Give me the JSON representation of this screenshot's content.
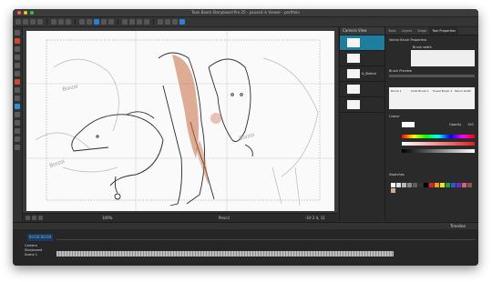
{
  "window": {
    "title": "Toon Boom Storyboard Pro 25 - paused in Viewer - portfolio"
  },
  "canvas": {
    "zoom": "100%",
    "view_mode": "Pencil",
    "coordinates": "-10 2 4, 11"
  },
  "layers": {
    "header": "Camera View",
    "items": [
      {
        "label": ""
      },
      {
        "label": ""
      },
      {
        "label": "A_Sketch"
      },
      {
        "label": ""
      },
      {
        "label": ""
      }
    ]
  },
  "tool_properties": {
    "tabs": [
      "Tools",
      "Layers",
      "Stage",
      "Tool Properties"
    ],
    "brush_title": "Vector Brush Properties",
    "brush_preset_label": "Brush width",
    "preview_label": "Brush Preview",
    "presets": [
      "Brush 1",
      "Solid Brush 1",
      "Fused Brush 1",
      "Pencil width"
    ],
    "color_section": "Colour",
    "opacity_label": "Opacity",
    "opacity_value": "100",
    "swatches_section": "Swatches"
  },
  "timeline": {
    "panel": "Timeline",
    "timecode": "00:00:00:00",
    "rows": [
      "Camera",
      "Storyboard",
      "Scene 1"
    ]
  },
  "colors": {
    "swatches": [
      "#ffffff",
      "#e0e0e0",
      "#b8b8b8",
      "#8a8a8a",
      "#5e5e5e",
      "#333333",
      "#000000",
      "#d8232a",
      "#f29a1f",
      "#f4e01c",
      "#2c9a3c",
      "#1c5fd8",
      "#6d2fb5",
      "#d1628f",
      "#8a5a3b",
      "#c9b28c"
    ]
  }
}
